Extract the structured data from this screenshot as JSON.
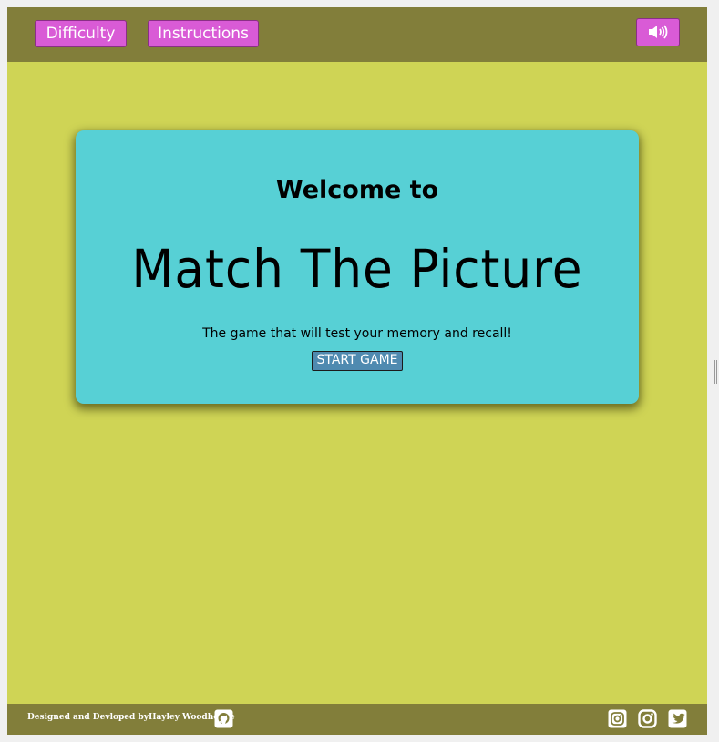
{
  "header": {
    "difficulty_label": "Difficulty",
    "instructions_label": "Instructions",
    "sound_icon": "volume-icon"
  },
  "welcome_card": {
    "welcome_text": "Welcome to",
    "title": "Match The Picture",
    "tagline": "The game that will test your memory and recall!",
    "start_label": "START GAME"
  },
  "footer": {
    "credit": "Designed and Devloped byHayley Woodhouse",
    "github_icon": "github-icon",
    "social_icons": [
      "instagram-icon",
      "instagram-icon",
      "twitter-icon"
    ]
  },
  "colors": {
    "background": "#cfd455",
    "bar": "#827e3a",
    "button": "#d95bd6",
    "card": "#57d0d5",
    "start_button": "#4f8ab0"
  }
}
